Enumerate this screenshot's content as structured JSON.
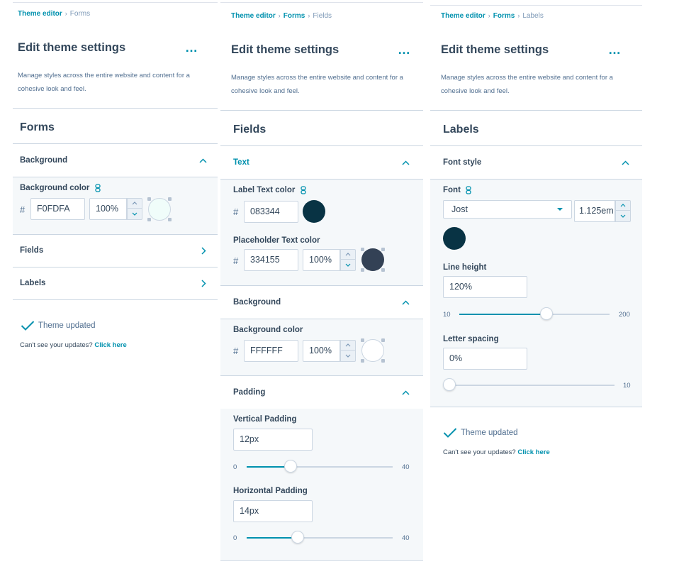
{
  "colors": {
    "accent": "#0091ae",
    "text": "#33475b",
    "darkSwatch": "#083344",
    "slateSwatch": "#334155",
    "lightSwatch": "#F0FDFA"
  },
  "panel1": {
    "breadcrumb": [
      "Theme editor",
      "Forms"
    ],
    "title": "Edit theme settings",
    "more": "…",
    "description": "Manage styles across the entire website and content for a cohesive look and feel.",
    "section": "Forms",
    "background": {
      "label": "Background",
      "color_label": "Background color",
      "hash": "#",
      "hex": "F0FDFA",
      "opacity": "100%"
    },
    "fields": "Fields",
    "labels": "Labels",
    "status": "Theme updated",
    "help_text": "Can't see your updates?",
    "help_link": "Click here"
  },
  "panel2": {
    "breadcrumb": [
      "Theme editor",
      "Forms",
      "Fields"
    ],
    "title": "Edit theme settings",
    "more": "…",
    "description": "Manage styles across the entire website and content for a cohesive look and feel.",
    "section": "Fields",
    "text": {
      "label": "Text",
      "label_color_label": "Label Text color",
      "label_hex": "083344",
      "placeholder_label": "Placeholder Text color",
      "placeholder_hex": "334155",
      "placeholder_opacity": "100%",
      "hash": "#"
    },
    "background": {
      "label": "Background",
      "color_label": "Background color",
      "hex": "FFFFFF",
      "opacity": "100%",
      "hash": "#"
    },
    "padding": {
      "label": "Padding",
      "vertical_label": "Vertical Padding",
      "vertical_value": "12px",
      "vertical_level": 12,
      "horizontal_label": "Horizontal Padding",
      "horizontal_value": "14px",
      "horizontal_level": 14,
      "min": "0",
      "max": "40"
    }
  },
  "panel3": {
    "breadcrumb": [
      "Theme editor",
      "Forms",
      "Labels"
    ],
    "title": "Edit theme settings",
    "more": "…",
    "description": "Manage styles across the entire website and content for a cohesive look and feel.",
    "section": "Labels",
    "font_style": {
      "label": "Font style",
      "font_label": "Font",
      "font_value": "Jost",
      "font_size": "1.125em",
      "line_height_label": "Line height",
      "line_height_value": "120%",
      "line_height_level": 120,
      "line_height_min": "10",
      "line_height_max": "200",
      "letter_spacing_label": "Letter spacing",
      "letter_spacing_value": "0%",
      "letter_spacing_level": 0,
      "letter_spacing_min": "0",
      "letter_spacing_max": "10"
    },
    "status": "Theme updated",
    "help_text": "Can't see your updates?",
    "help_link": "Click here"
  }
}
